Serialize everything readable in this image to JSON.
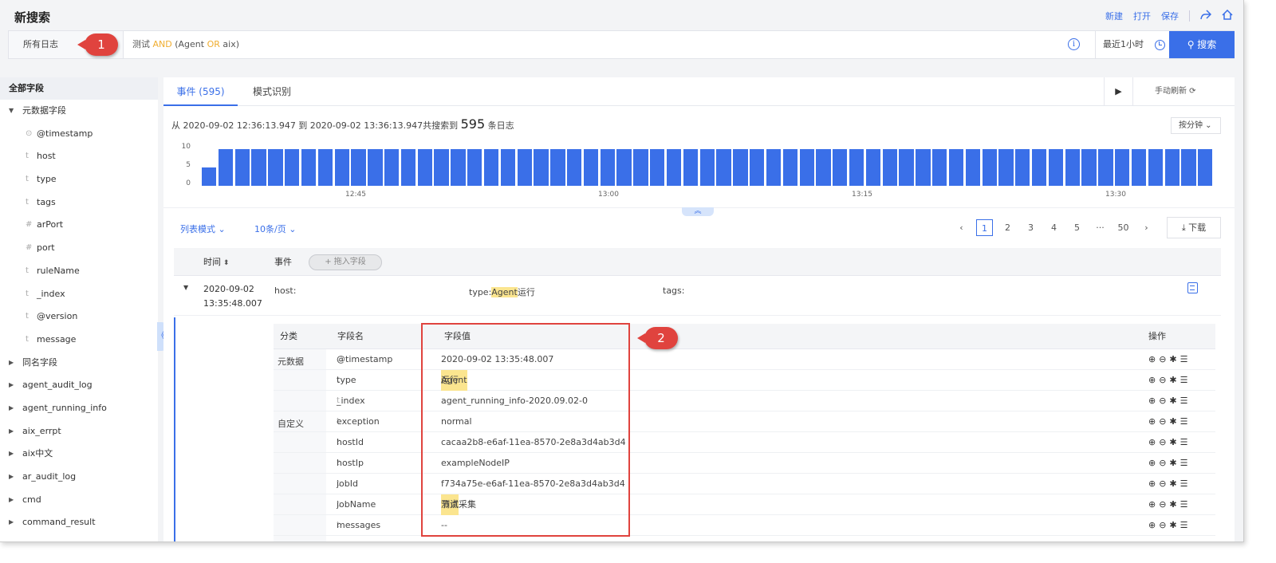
{
  "header": {
    "title": "新搜索",
    "actions": {
      "new": "新建",
      "open": "打开",
      "save": "保存"
    }
  },
  "search": {
    "scope": "所有日志",
    "query": {
      "t1": "测试 ",
      "k1": "AND",
      "t2": " (Agent ",
      "k2": "OR",
      "t3": " aix)"
    },
    "time_range": "最近1小时",
    "search_button": "搜索"
  },
  "markers": {
    "m1": "1",
    "m2": "2"
  },
  "sidebar": {
    "heading": "全部字段",
    "meta_group": "元数据字段",
    "meta_fields": [
      {
        "type": "⊙",
        "name": "@timestamp"
      },
      {
        "type": "t",
        "name": "host"
      },
      {
        "type": "t",
        "name": "type"
      },
      {
        "type": "t",
        "name": "tags"
      },
      {
        "type": "#",
        "name": "arPort"
      },
      {
        "type": "#",
        "name": "port"
      },
      {
        "type": "t",
        "name": "ruleName"
      },
      {
        "type": "t",
        "name": "_index"
      },
      {
        "type": "t",
        "name": "@version"
      },
      {
        "type": "t",
        "name": "message"
      }
    ],
    "groups": [
      "同名字段",
      "agent_audit_log",
      "agent_running_info",
      "aix_errpt",
      "aix中文",
      "ar_audit_log",
      "cmd",
      "command_result"
    ]
  },
  "main": {
    "tabs": {
      "events": "事件 (595)",
      "pattern": "模式识别"
    },
    "refresh": "手动刷新",
    "summary": {
      "prefix": "从 2020-09-02 12:36:13.947 到 2020-09-02 13:36:13.947共搜索到 ",
      "count": "595",
      "suffix": " 条日志"
    },
    "interval": "按分钟",
    "list_mode": "列表模式",
    "per_page": "10条/页",
    "pager": {
      "p1": "1",
      "p2": "2",
      "p3": "3",
      "p4": "4",
      "p5": "5",
      "ellipsis": "···",
      "last": "50"
    },
    "download": "下载",
    "table_headers": {
      "time": "时间",
      "event": "事件",
      "drag_field": "拖入字段"
    },
    "event_row": {
      "time_date": "2020-09-02",
      "time_clock": "13:35:48.007",
      "host_label": "host:",
      "type_label": "type:",
      "type_hl": "Agent",
      "type_rest": "运行",
      "tags_label": "tags:"
    },
    "detail": {
      "headers": {
        "category": "分类",
        "field": "字段名",
        "value": "字段值",
        "ops": "操作"
      },
      "categories": {
        "meta": "元数据",
        "custom": "自定义"
      },
      "rows": [
        {
          "type": "⊙",
          "field": "@timestamp",
          "value_hl": "",
          "value": "2020-09-02 13:35:48.007"
        },
        {
          "type": "t",
          "field": "type",
          "value_hl": "Agent",
          "value": "运行"
        },
        {
          "type": "t",
          "field": "_index",
          "value_hl": "",
          "value": "agent_running_info-2020.09.02-0"
        },
        {
          "type": "t",
          "field": "exception",
          "value_hl": "",
          "value": "normal"
        },
        {
          "type": "t",
          "field": "hostId",
          "value_hl": "",
          "value": "cacaa2b8-e6af-11ea-8570-2e8a3d4ab3d4"
        },
        {
          "type": "t",
          "field": "hostIp",
          "value_hl": "",
          "value": "exampleNodeIP"
        },
        {
          "type": "t",
          "field": "jobId",
          "value_hl": "",
          "value": "f734a75e-e6af-11ea-8570-2e8a3d4ab3d4"
        },
        {
          "type": "t",
          "field": "jobName",
          "value_hl": "测试",
          "value": "节点采集"
        },
        {
          "type": "t",
          "field": "messages",
          "value_hl": "",
          "value": "--"
        }
      ],
      "ops_icons": "⊕⊖✱☰"
    }
  },
  "chart_data": {
    "type": "bar",
    "yticks": [
      "10",
      "5",
      "0"
    ],
    "ylim": [
      0,
      10
    ],
    "xticks": [
      "12:45",
      "13:00",
      "13:15",
      "13:30"
    ],
    "values": [
      5,
      10,
      10,
      10,
      10,
      10,
      10,
      10,
      10,
      10,
      10,
      10,
      10,
      10,
      10,
      10,
      10,
      10,
      10,
      10,
      10,
      10,
      10,
      10,
      10,
      10,
      10,
      10,
      10,
      10,
      10,
      10,
      10,
      10,
      10,
      10,
      10,
      10,
      10,
      10,
      10,
      10,
      10,
      10,
      10,
      10,
      10,
      10,
      10,
      10,
      10,
      10,
      10,
      10,
      10,
      10,
      10,
      10,
      10,
      10,
      10
    ],
    "color": "#3a6fe8"
  }
}
